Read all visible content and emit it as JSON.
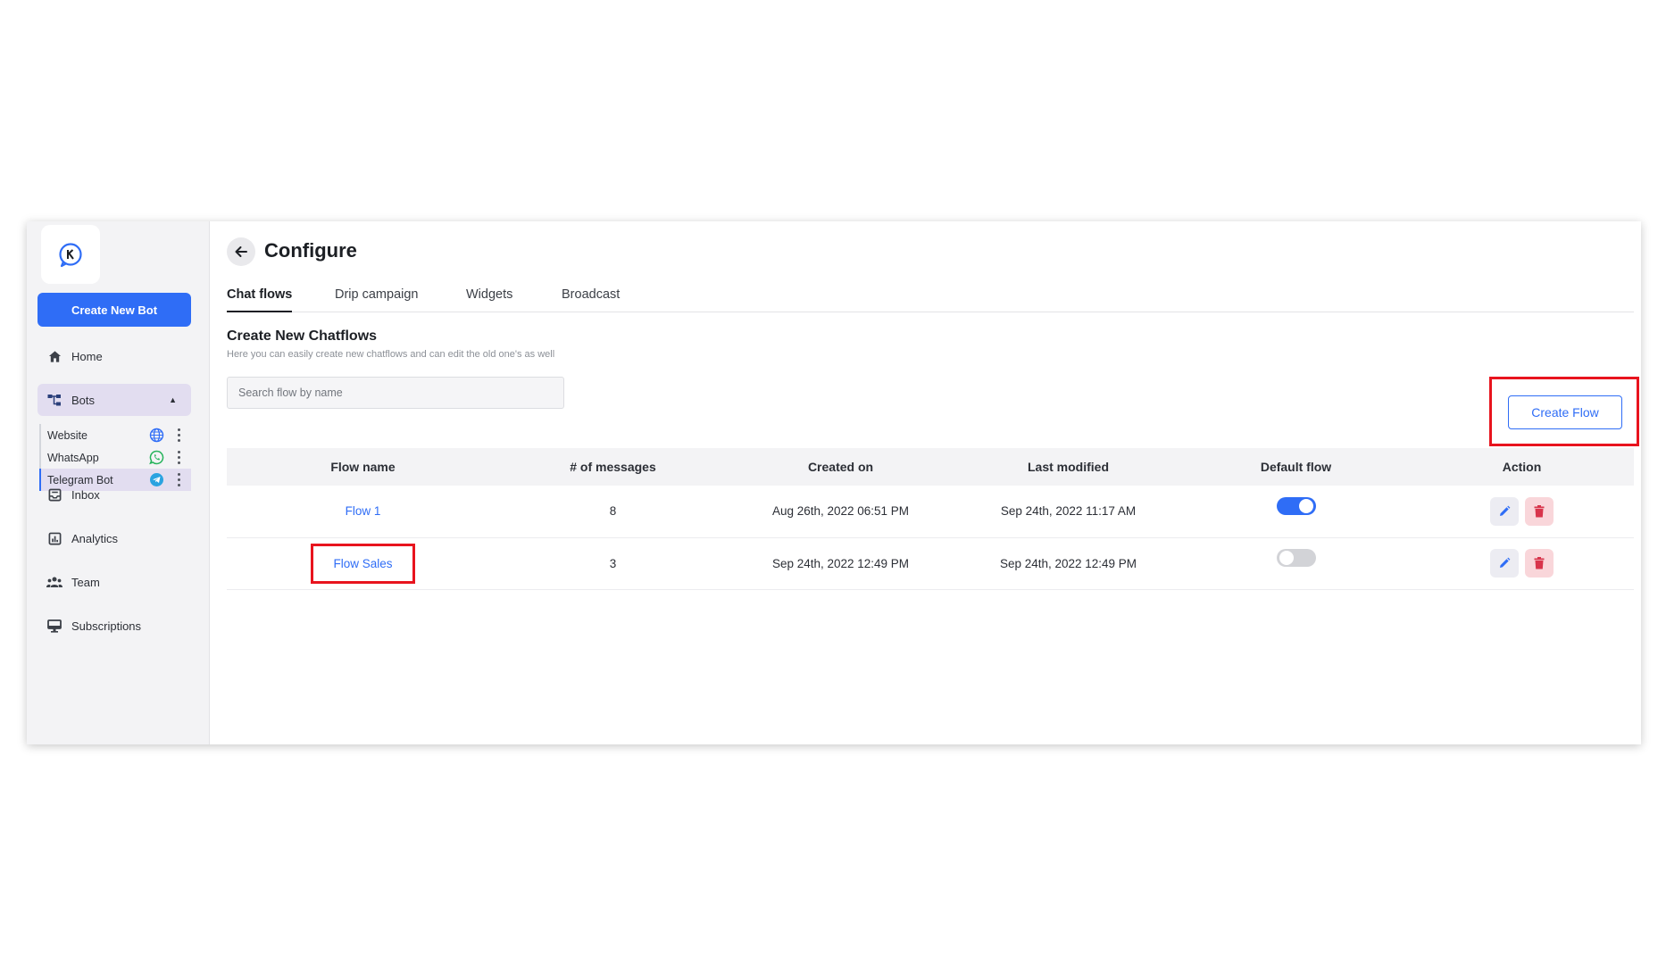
{
  "sidebar": {
    "create_bot_label": "Create New Bot",
    "nav": {
      "home": "Home",
      "bots": "Bots",
      "inbox": "Inbox",
      "analytics": "Analytics",
      "team": "Team",
      "subscriptions": "Subscriptions"
    },
    "bots": [
      {
        "label": "Website",
        "icon": "globe-icon"
      },
      {
        "label": "WhatsApp",
        "icon": "whatsapp-icon"
      },
      {
        "label": "Telegram Bot",
        "icon": "telegram-icon"
      }
    ]
  },
  "header": {
    "title": "Configure"
  },
  "tabs": [
    "Chat flows",
    "Drip campaign",
    "Widgets",
    "Broadcast"
  ],
  "section": {
    "title": "Create New Chatflows",
    "subtitle": "Here you can easily create new chatflows and can edit the old one's as well"
  },
  "search": {
    "placeholder": "Search flow by name",
    "value": ""
  },
  "create_flow_label": "Create Flow",
  "table": {
    "columns": [
      "Flow name",
      "# of messages",
      "Created on",
      "Last modified",
      "Default flow",
      "Action"
    ],
    "rows": [
      {
        "name": "Flow 1",
        "messages": "8",
        "created": "Aug 26th, 2022 06:51 PM",
        "modified": "Sep 24th, 2022 11:17 AM",
        "default": true
      },
      {
        "name": "Flow Sales",
        "messages": "3",
        "created": "Sep 24th, 2022 12:49 PM",
        "modified": "Sep 24th, 2022 12:49 PM",
        "default": false
      }
    ]
  },
  "colors": {
    "accent": "#2f6df6",
    "highlight": "#e8141e",
    "delete": "#d8344b",
    "whatsapp": "#25b35a",
    "telegram": "#2aa3e0"
  }
}
